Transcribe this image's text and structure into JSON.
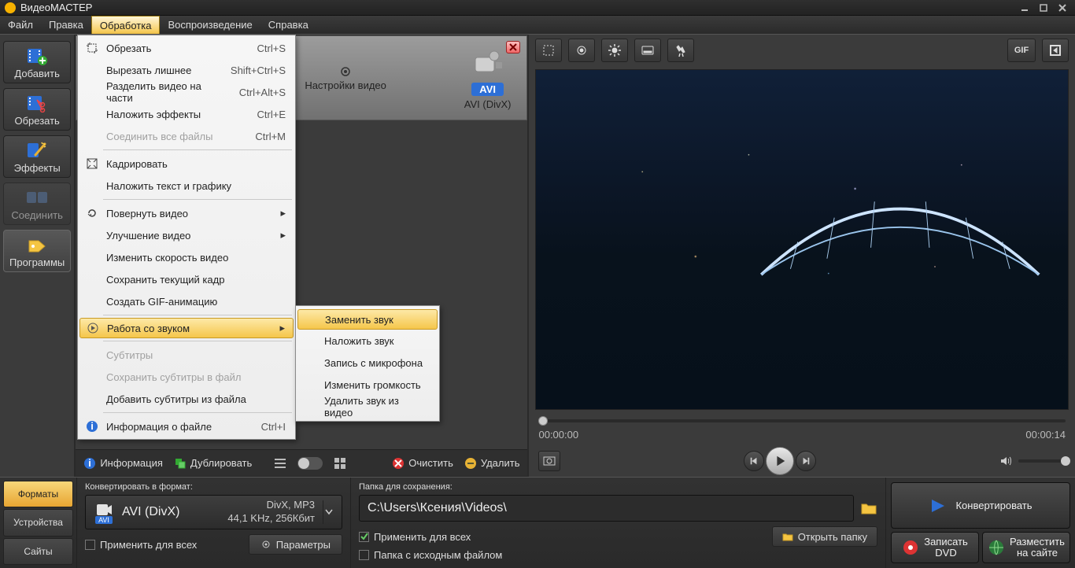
{
  "app": {
    "title": "ВидеоМАСТЕР"
  },
  "menubar": [
    "Файл",
    "Правка",
    "Обработка",
    "Воспроизведение",
    "Справка"
  ],
  "menubarActive": 2,
  "ltool": {
    "add": "Добавить",
    "cut": "Обрезать",
    "fx": "Эффекты",
    "join": "Соединить",
    "apps": "Программы"
  },
  "dropdown": {
    "items": [
      {
        "label": "Обрезать",
        "shortcut": "Ctrl+S",
        "icon": "crop"
      },
      {
        "label": "Вырезать лишнее",
        "shortcut": "Shift+Ctrl+S"
      },
      {
        "label": "Разделить видео на части",
        "shortcut": "Ctrl+Alt+S"
      },
      {
        "label": "Наложить эффекты",
        "shortcut": "Ctrl+E"
      },
      {
        "label": "Соединить все файлы",
        "shortcut": "Ctrl+M",
        "disabled": true
      },
      {
        "sep": true
      },
      {
        "label": "Кадрировать",
        "icon": "frame"
      },
      {
        "label": "Наложить текст и графику"
      },
      {
        "sep": true
      },
      {
        "label": "Повернуть видео",
        "sub": true,
        "icon": "rotate"
      },
      {
        "label": "Улучшение видео",
        "sub": true
      },
      {
        "label": "Изменить скорость видео"
      },
      {
        "label": "Сохранить текущий кадр"
      },
      {
        "label": "Создать GIF-анимацию"
      },
      {
        "sep": true
      },
      {
        "label": "Работа со звуком",
        "sub": true,
        "hover": true,
        "icon": "audio"
      },
      {
        "sep": true
      },
      {
        "label": "Субтитры",
        "disabled": true
      },
      {
        "label": "Сохранить субтитры в файл",
        "disabled": true
      },
      {
        "label": "Добавить субтитры из файла"
      },
      {
        "sep": true
      },
      {
        "label": "Информация о файле",
        "shortcut": "Ctrl+I",
        "icon": "info"
      }
    ],
    "submenu": [
      {
        "label": "Заменить звук",
        "hover": true
      },
      {
        "label": "Наложить звук"
      },
      {
        "label": "Запись с микрофона"
      },
      {
        "label": "Изменить громкость"
      },
      {
        "label": "Удалить звук из видео"
      }
    ]
  },
  "filebar": {
    "videoSettings": "Настройки видео",
    "format": "AVI",
    "formatFull": "AVI (DivX)"
  },
  "filebottom": {
    "info": "Информация",
    "dup": "Дублировать",
    "clear": "Очистить",
    "del": "Удалить"
  },
  "times": {
    "cur": "00:00:00",
    "dur": "00:00:14"
  },
  "tabs": {
    "formats": "Форматы",
    "devices": "Устройства",
    "sites": "Сайты"
  },
  "format": {
    "label": "Конвертировать в формат:",
    "name": "AVI (DivX)",
    "meta1": "DivX, MP3",
    "meta2": "44,1 KHz, 256Кбит",
    "applyAll": "Применить для всех",
    "params": "Параметры"
  },
  "folder": {
    "label": "Папка для сохранения:",
    "path": "C:\\Users\\Ксения\\Videos\\",
    "applyAll": "Применить для всех",
    "sameAsSrc": "Папка с исходным файлом",
    "open": "Открыть папку"
  },
  "actions": {
    "convert": "Конвертировать",
    "burn1": "Записать",
    "burn2": "DVD",
    "upload1": "Разместить",
    "upload2": "на сайте"
  },
  "gif": "GIF"
}
